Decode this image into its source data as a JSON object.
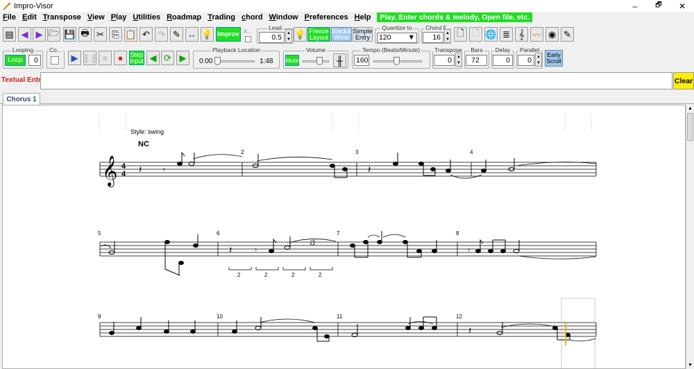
{
  "window": {
    "title": "Impro-Visor",
    "minimize": "–",
    "restore": "🗗",
    "close": "✕"
  },
  "menu": {
    "items": [
      "File",
      "Edit",
      "Transpose",
      "View",
      "Play",
      "Utilities",
      "Roadmap",
      "Trading",
      "chord",
      "Window",
      "Preferences",
      "Help"
    ],
    "hint": "Play, Enter chords & melody, Open file, etc."
  },
  "toolbar1": {
    "improv_label": "Improv",
    "x_label": "X...",
    "lead_label": "Lead",
    "lead_value": "0.5",
    "freeze_label": "Freeze Layout",
    "bw_label": "Black& White",
    "simple_label": "Simple Entry",
    "quantize_label": "Quantize to",
    "quantize_value": "120",
    "chordf_label": "Chord F",
    "chordf_value": "16"
  },
  "toolbar2": {
    "looping_label": "Looping",
    "loop_button": "Loop",
    "loop_count": "0",
    "co_label": "Co...",
    "step_input": "Step Input",
    "playback_label": "Playback Location",
    "playback_start": "0:00",
    "playback_end": "1:48",
    "volume_label": "Volume",
    "mute_label": "Mute",
    "tempo_label": "Tempo (Beats/Minute)",
    "tempo_value": "160",
    "transpose_label": "Transpose",
    "transpose_value": "0",
    "bars_label": "Bars",
    "bars_value": "72",
    "delay_label": "Delay",
    "delay_value": "0",
    "parallel_label": "Parallel",
    "parallel_value": "0",
    "early_scroll": "Early Scroll"
  },
  "textual": {
    "label": "Textual Entry",
    "value": "",
    "clear": "Clear"
  },
  "tabs": [
    {
      "label": "Chorus 1"
    }
  ],
  "score": {
    "style_text": "Style: swing",
    "chord_text": "NC",
    "time_sig_top": "4",
    "time_sig_bottom": "4",
    "measure_numbers": [
      "2",
      "3",
      "4",
      "5",
      "6",
      "7",
      "8",
      "9",
      "10",
      "11",
      "12"
    ],
    "triplet_labels": [
      "2",
      "2",
      "2",
      "2"
    ],
    "chord_marker": "d"
  },
  "colors": {
    "hint_green": "#22dd22",
    "clear_yellow": "#ffee00",
    "textual_red": "#d02020",
    "cursor": "#f0b400"
  }
}
